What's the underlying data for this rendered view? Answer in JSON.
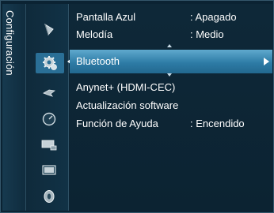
{
  "menu": {
    "category_label": "Configuración",
    "icons": [
      {
        "name": "picture-icon"
      },
      {
        "name": "setup-gear-icon",
        "active": true
      },
      {
        "name": "sound-icon"
      },
      {
        "name": "channel-icon"
      },
      {
        "name": "input-icon"
      },
      {
        "name": "application-icon"
      },
      {
        "name": "support-icon"
      }
    ],
    "items": [
      {
        "label": "Pantalla Azul",
        "value": ": Apagado"
      },
      {
        "label": "Melodía",
        "value": ": Medio"
      },
      {
        "label": "Bluetooth",
        "value": ""
      },
      {
        "label": "Anynet+ (HDMI-CEC)",
        "value": ""
      },
      {
        "label": "Actualización software",
        "value": ""
      },
      {
        "label": "Función de Ayuda",
        "value": ": Encendido"
      }
    ],
    "selected_index": 2
  },
  "colors": {
    "background": "#0b2333",
    "highlight": "#2e7ca6",
    "text": "#ffffff"
  }
}
